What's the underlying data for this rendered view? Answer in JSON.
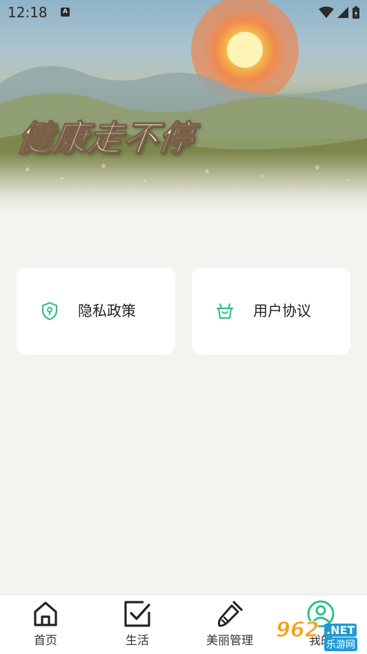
{
  "status_bar": {
    "time": "12:18",
    "notification_letter": "A",
    "icons": [
      "wifi-icon",
      "signal-icon",
      "battery-icon"
    ]
  },
  "hero": {
    "title": "健康走不停"
  },
  "cards": {
    "privacy": {
      "label": "隐私政策",
      "icon": "shield-lock-icon"
    },
    "terms": {
      "label": "用户协议",
      "icon": "basket-icon"
    }
  },
  "bottom_nav": {
    "items": [
      {
        "label": "首页",
        "icon": "home-icon"
      },
      {
        "label": "生活",
        "icon": "checkbox-icon"
      },
      {
        "label": "美丽管理",
        "icon": "brush-icon"
      },
      {
        "label": "我的",
        "icon": "user-icon"
      }
    ]
  },
  "watermark": {
    "number": "962",
    "domain": ".NET",
    "name": "乐游网"
  },
  "colors": {
    "accent": "#2bbf8a",
    "background": "#f4f3f0",
    "card": "#ffffff"
  }
}
